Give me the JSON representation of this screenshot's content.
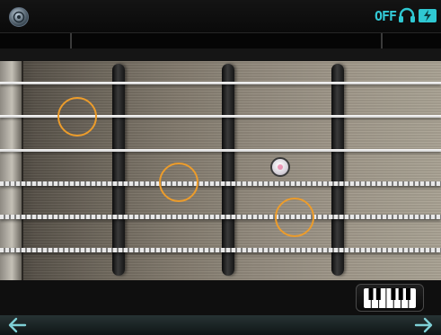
{
  "status_bar": {
    "audio_status_label": "OFF",
    "icons": [
      "app-logo-icon",
      "headphones-icon",
      "battery-charging-icon"
    ],
    "accent_color": "#2fc8d2"
  },
  "fretboard": {
    "string_count": 6,
    "fret_count": 3,
    "marker_color": "#ec9c2b",
    "marker_count": 3
  },
  "controls": {
    "keyboard_button_icon": "piano-keys-icon",
    "nav_back_icon": "arrow-left-icon",
    "nav_forward_icon": "arrow-right-icon"
  }
}
